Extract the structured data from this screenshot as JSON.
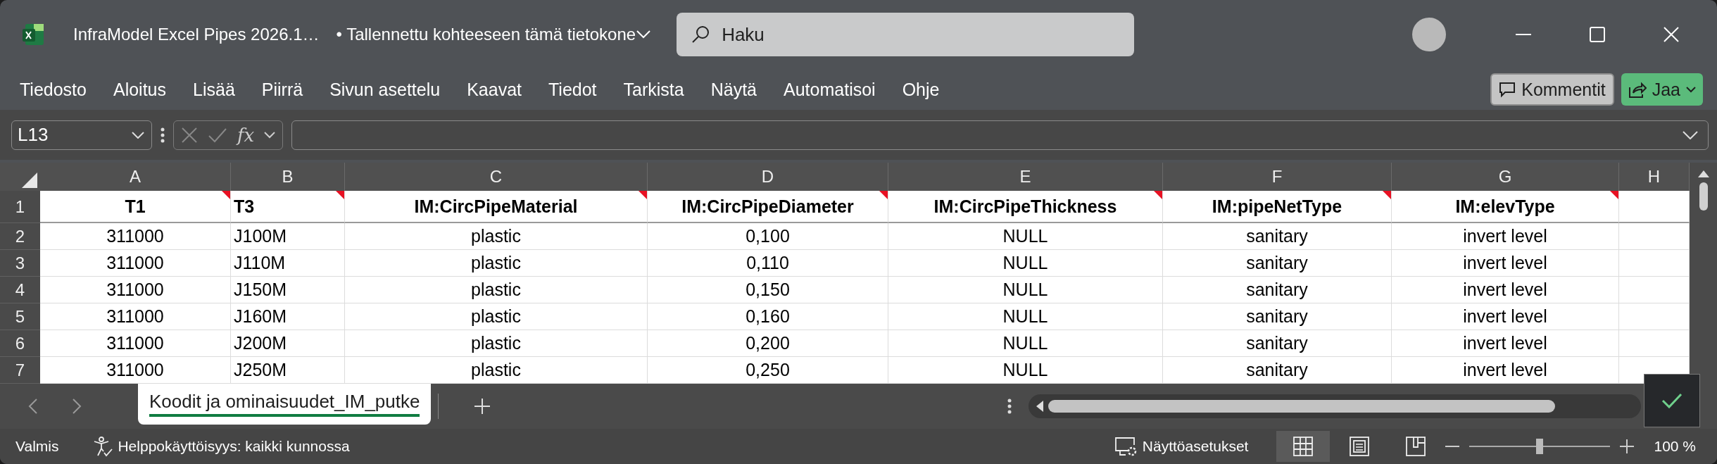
{
  "title_bar": {
    "file_name": "InfraModel Excel Pipes 2026.1…",
    "save_status": "• Tallennettu kohteeseen tämä tietokone",
    "search": {
      "placeholder": "Haku"
    }
  },
  "ribbon": {
    "tabs": [
      "Tiedosto",
      "Aloitus",
      "Lisää",
      "Piirrä",
      "Sivun asettelu",
      "Kaavat",
      "Tiedot",
      "Tarkista",
      "Näytä",
      "Automatisoi",
      "Ohje"
    ],
    "comments_button": "Kommentit",
    "share_button": "Jaa"
  },
  "formula_bar": {
    "name_box": "L13",
    "function_label": "fx"
  },
  "sheet": {
    "columns": [
      "A",
      "B",
      "C",
      "D",
      "E",
      "F",
      "G",
      "H"
    ],
    "rows": [
      {
        "number": "1",
        "cells": [
          {
            "text": "T1",
            "comment": true
          },
          {
            "text": "T3",
            "comment": true
          },
          {
            "text": "IM:CircPipeMaterial",
            "comment": true
          },
          {
            "text": "IM:CircPipeDiameter",
            "comment": true
          },
          {
            "text": "IM:CircPipeThickness",
            "comment": true
          },
          {
            "text": "IM:pipeNetType",
            "comment": true
          },
          {
            "text": "IM:elevType",
            "comment": true
          }
        ]
      },
      {
        "number": "2",
        "cells": [
          {
            "text": "311000"
          },
          {
            "text": "J100M"
          },
          {
            "text": "plastic"
          },
          {
            "text": "0,100"
          },
          {
            "text": "NULL"
          },
          {
            "text": "sanitary"
          },
          {
            "text": "invert level"
          }
        ]
      },
      {
        "number": "3",
        "cells": [
          {
            "text": "311000"
          },
          {
            "text": "J110M"
          },
          {
            "text": "plastic"
          },
          {
            "text": "0,110"
          },
          {
            "text": "NULL"
          },
          {
            "text": "sanitary"
          },
          {
            "text": "invert level"
          }
        ]
      },
      {
        "number": "4",
        "cells": [
          {
            "text": "311000"
          },
          {
            "text": "J150M"
          },
          {
            "text": "plastic"
          },
          {
            "text": "0,150"
          },
          {
            "text": "NULL"
          },
          {
            "text": "sanitary"
          },
          {
            "text": "invert level"
          }
        ]
      },
      {
        "number": "5",
        "cells": [
          {
            "text": "311000"
          },
          {
            "text": "J160M"
          },
          {
            "text": "plastic"
          },
          {
            "text": "0,160"
          },
          {
            "text": "NULL"
          },
          {
            "text": "sanitary"
          },
          {
            "text": "invert level"
          }
        ]
      },
      {
        "number": "6",
        "cells": [
          {
            "text": "311000"
          },
          {
            "text": "J200M"
          },
          {
            "text": "plastic"
          },
          {
            "text": "0,200"
          },
          {
            "text": "NULL"
          },
          {
            "text": "sanitary"
          },
          {
            "text": "invert level"
          }
        ]
      },
      {
        "number": "7",
        "cells": [
          {
            "text": "311000"
          },
          {
            "text": "J250M"
          },
          {
            "text": "plastic"
          },
          {
            "text": "0,250"
          },
          {
            "text": "NULL"
          },
          {
            "text": "sanitary"
          },
          {
            "text": "invert level"
          }
        ]
      }
    ]
  },
  "sheet_tabs": [
    {
      "label": "Koodit ja ominaisuudet_IM_putke",
      "selected": true
    }
  ],
  "status_bar": {
    "mode": "Valmis",
    "accessibility": "Helppokäyttöisyys: kaikki kunnossa",
    "display_settings": "Näyttöasetukset",
    "views": [
      {
        "kind": "normal",
        "selected": true
      },
      {
        "kind": "page_layout",
        "selected": false
      },
      {
        "kind": "page_break",
        "selected": false
      }
    ],
    "zoom": {
      "level": 0.5,
      "reading": "100 %"
    }
  }
}
